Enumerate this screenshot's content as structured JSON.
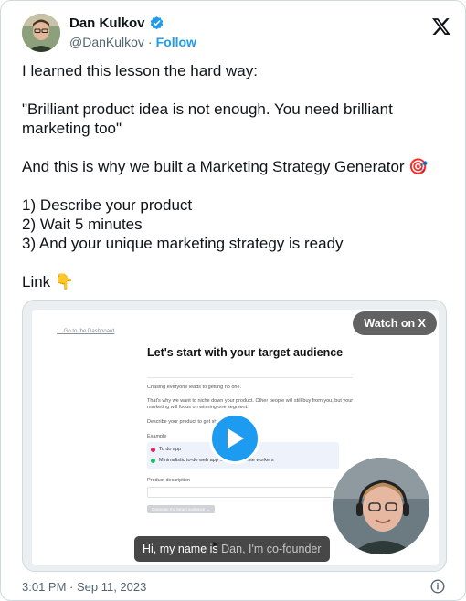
{
  "author": {
    "name": "Dan Kulkov",
    "handle": "@DanKulkov",
    "separator": "·",
    "follow_label": "Follow"
  },
  "tweet": {
    "lines": [
      "I learned this lesson the hard way:",
      "",
      "\"Brilliant product idea is not enough. You need brilliant marketing too\"",
      "",
      "And this is why we built a Marketing Strategy Generator 🎯",
      "",
      "1) Describe your product",
      "2) Wait 5 minutes",
      "3) And your unique marketing strategy is ready",
      "",
      "Link 👇"
    ]
  },
  "media": {
    "watch_label": "Watch on X",
    "subtitle_bright": "Hi, my name is",
    "subtitle_dim": "Dan, I'm co-founder",
    "screen": {
      "back_link": "← Go to the Dashboard",
      "title": "Let's start with your target audience",
      "intro": "Chasing everyone leads to getting no one.",
      "paragraph": "That's why we want to niche down your product. Other people will still buy from you, but your marketing will focus on winning one segment.",
      "prompt": "Describe your product to get started",
      "example_label": "Example",
      "example_bad": "To do app",
      "example_good": "Minimalistic to-do web app ... us for remote workers",
      "field_label": "Product description",
      "button_label": "Generate my target audience →"
    }
  },
  "footer": {
    "timestamp": "3:01 PM · Sep 11, 2023"
  },
  "colors": {
    "accent": "#1d9bf0",
    "text": "#0f1419",
    "muted": "#536471"
  }
}
